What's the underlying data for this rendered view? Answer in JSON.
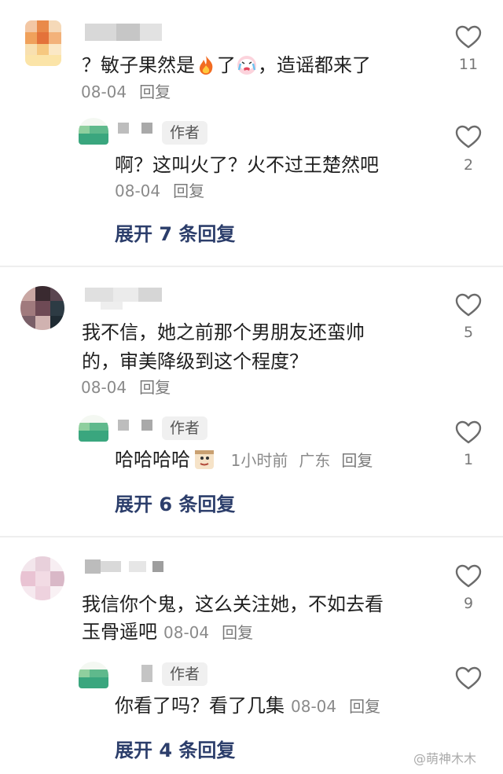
{
  "comments": [
    {
      "text": "？敏子果然是",
      "text_after_fire": "了",
      "text_after_cry": "，造谣都来了",
      "date": "08-04",
      "reply_label": "回复",
      "likes": "11",
      "sub": {
        "author_badge": "作者",
        "text": "啊？这叫火了？火不过王楚然吧",
        "date": "08-04",
        "reply_label": "回复",
        "likes": "2"
      },
      "expand": "展开 7 条回复"
    },
    {
      "text_line1": "我不信，她之前那个男朋友还蛮帅",
      "text_line2": "的，审美降级到这个程度？",
      "date": "08-04",
      "reply_label": "回复",
      "likes": "5",
      "sub": {
        "author_badge": "作者",
        "text": "哈哈哈哈",
        "time": "1小时前",
        "location": "广东",
        "reply_label": "回复",
        "likes": "1"
      },
      "expand": "展开 6 条回复"
    },
    {
      "text_line1": "我信你个鬼，这么关注她，不如去看",
      "text_line2": "玉骨遥吧",
      "date": "08-04",
      "reply_label": "回复",
      "likes": "9",
      "sub": {
        "author_badge": "作者",
        "text": "你看了吗？看了几集",
        "date": "08-04",
        "reply_label": "回复",
        "likes": ""
      },
      "expand": "展开 4 条回复"
    }
  ],
  "watermark": "@萌神木木",
  "icons": {
    "like": "heart-outline-icon",
    "fire": "fire-emoji-icon",
    "cry": "crying-emoji-icon",
    "sticker": "sticker-emoji-icon"
  },
  "colors": {
    "expand_text": "#2c3e6b",
    "meta_text": "#8a8a8a",
    "divider": "#eeeeee"
  }
}
